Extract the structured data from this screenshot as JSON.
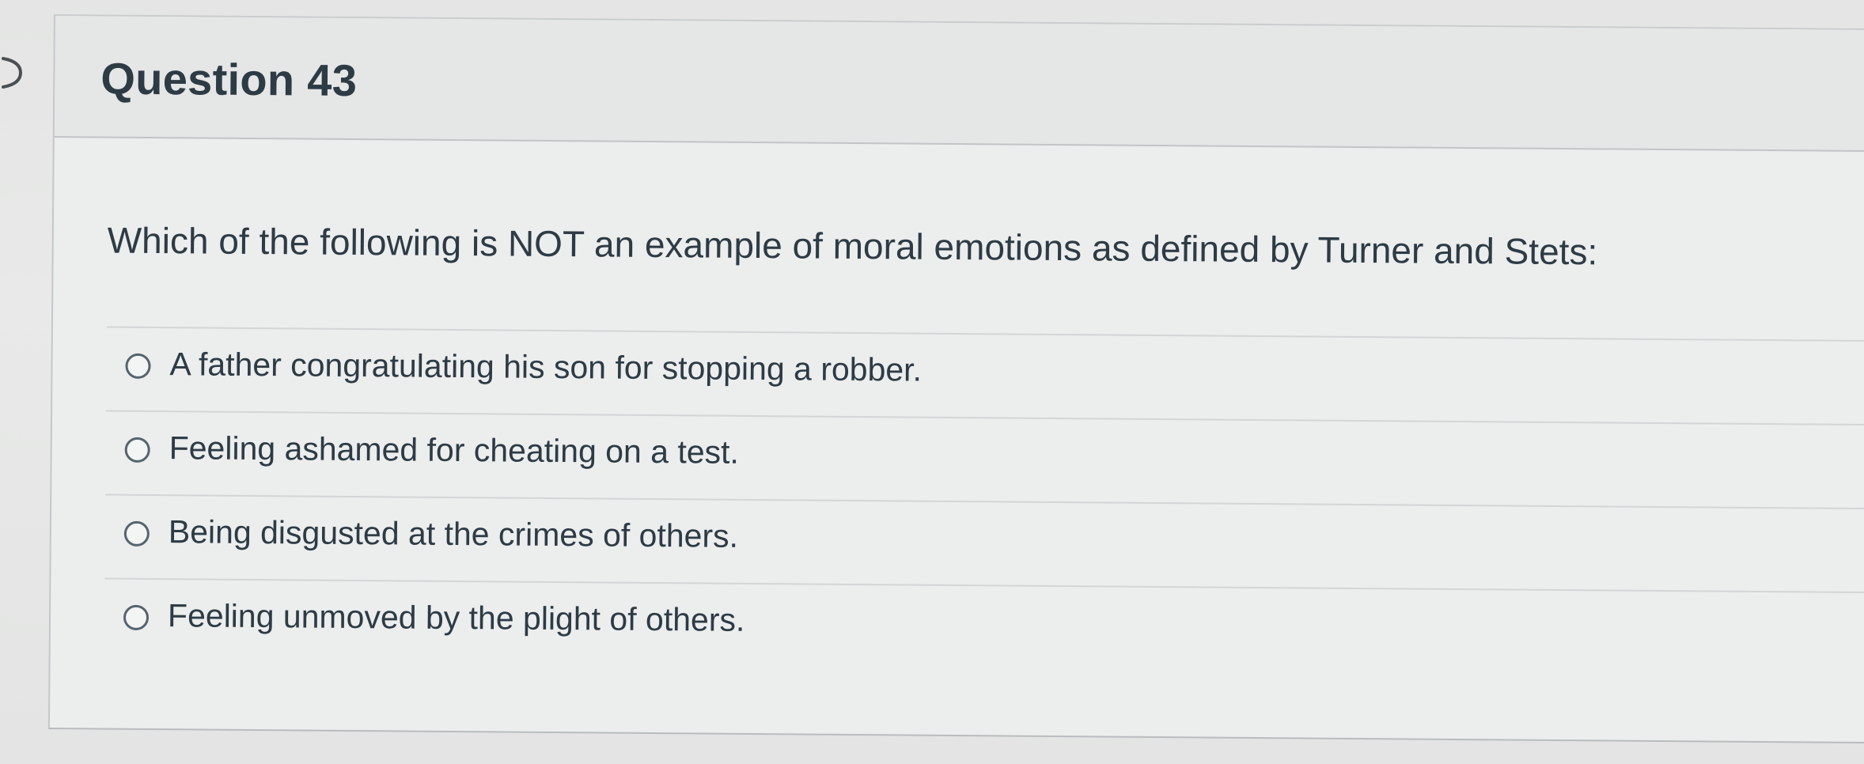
{
  "question": {
    "title": "Question 43",
    "text": "Which of the following is NOT an example of moral emotions as defined by Turner and Stets:",
    "answers": [
      {
        "label": "A father congratulating his son for stopping a robber."
      },
      {
        "label": "Feeling ashamed for cheating on a test."
      },
      {
        "label": "Being disgusted at the crimes of others."
      },
      {
        "label": "Feeling unmoved by the plight of others."
      }
    ]
  },
  "icons": {
    "collapse_toggle": "chevron-right-icon",
    "answer_option": "radio-button-icon"
  },
  "colors": {
    "text": "#2d3b45",
    "border": "#c2c5c7",
    "background": "#eceded"
  }
}
